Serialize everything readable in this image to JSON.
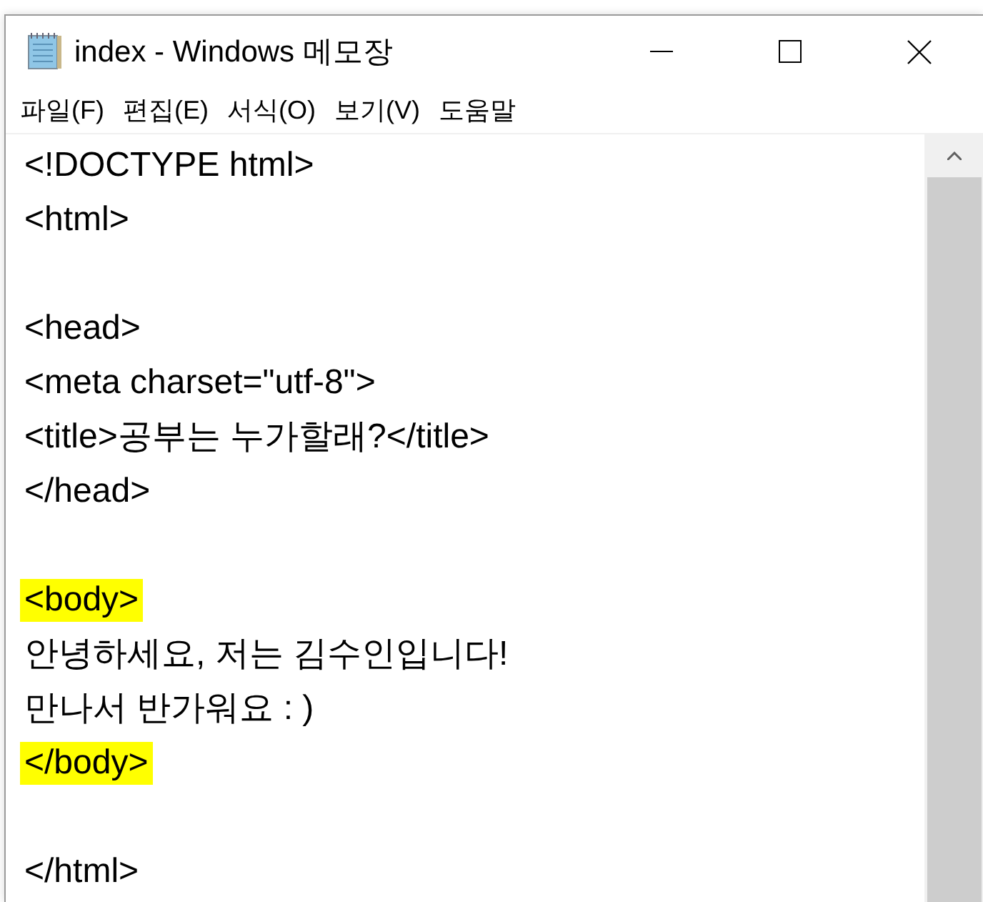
{
  "window": {
    "title": "index - Windows 메모장"
  },
  "menu": [
    "파일(F)",
    "편집(E)",
    "서식(O)",
    "보기(V)",
    "도움말"
  ],
  "editor": {
    "lines": [
      {
        "kind": "code",
        "text": "<!DOCTYPE html>",
        "highlighted": false
      },
      {
        "kind": "code",
        "text": "<html>",
        "highlighted": false
      },
      {
        "kind": "blank"
      },
      {
        "kind": "code",
        "text": "<head>",
        "highlighted": false
      },
      {
        "kind": "code",
        "text": "<meta charset=\"utf-8\">",
        "highlighted": false
      },
      {
        "kind": "code",
        "text": "<title>공부는 누가할래?</title>",
        "highlighted": false
      },
      {
        "kind": "code",
        "text": "</head>",
        "highlighted": false
      },
      {
        "kind": "blank"
      },
      {
        "kind": "code",
        "text": "<body>",
        "highlighted": true
      },
      {
        "kind": "code",
        "text": "안녕하세요, 저는 김수인입니다!",
        "highlighted": false
      },
      {
        "kind": "code",
        "text": "만나서 반가워요 : )",
        "highlighted": false
      },
      {
        "kind": "code",
        "text": "</body>",
        "highlighted": true
      },
      {
        "kind": "blank"
      },
      {
        "kind": "code",
        "text": "</html>",
        "highlighted": false
      }
    ]
  }
}
